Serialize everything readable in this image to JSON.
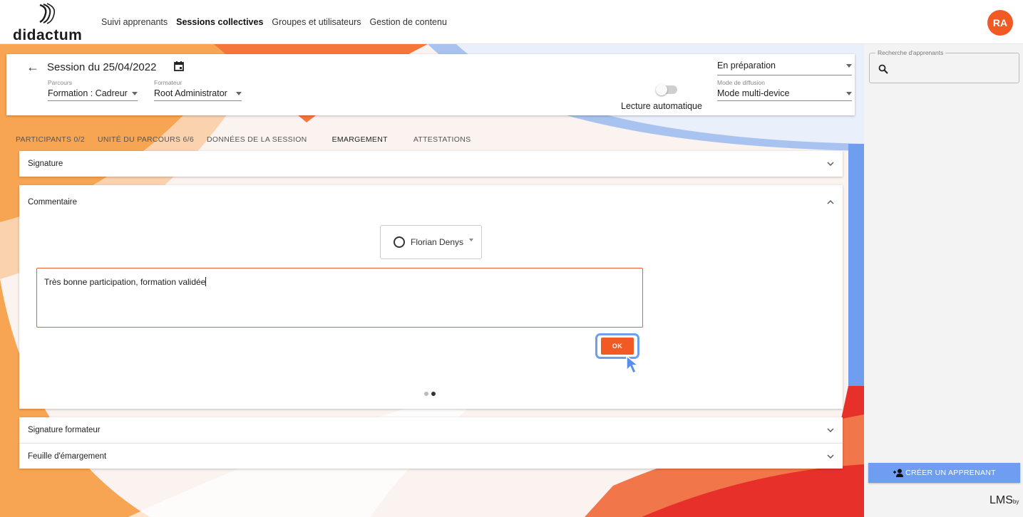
{
  "brand": {
    "name": "didactum"
  },
  "nav": {
    "items": [
      "Suivi apprenants",
      "Sessions collectives",
      "Groupes et utilisateurs",
      "Gestion de contenu"
    ],
    "active": "Sessions collectives"
  },
  "user": {
    "initials": "RA"
  },
  "session": {
    "title": "Session du 25/04/2022",
    "parcours_label": "Parcours",
    "parcours_value": "Formation : Cadreur",
    "formateur_label": "Formateur",
    "formateur_value": "Root Administrator",
    "status_value": "En préparation",
    "mode_label": "Mode de diffusion",
    "mode_value": "Mode multi-device",
    "auto_label": "Lecture automatique",
    "auto_enabled": false
  },
  "tabs": [
    {
      "label": "PARTICIPANTS 0/2"
    },
    {
      "label": "UNITÉ DU PARCOURS 6/6"
    },
    {
      "label": "DONNÉES DE LA SESSION"
    },
    {
      "label": "EMARGEMENT",
      "active": true
    },
    {
      "label": "ATTESTATIONS"
    }
  ],
  "sections": {
    "signature": "Signature",
    "commentaire": "Commentaire",
    "signature_formateur": "Signature formateur",
    "feuille": "Feuille d'émargement"
  },
  "comment": {
    "participant": "Florian Denys",
    "text": "Très bonne participation, formation validée",
    "ok_label": "OK",
    "pager_active": 2,
    "pager_total": 2
  },
  "sidebar": {
    "search_label": "Recherche d'apprenants",
    "create_label": "CRÉER UN APPRENANT",
    "footer_logo": "LMS",
    "footer_small": "by"
  },
  "colors": {
    "accent_orange": "#f15a24",
    "accent_blue": "#6f9df0",
    "accent_red": "#e8302a"
  }
}
